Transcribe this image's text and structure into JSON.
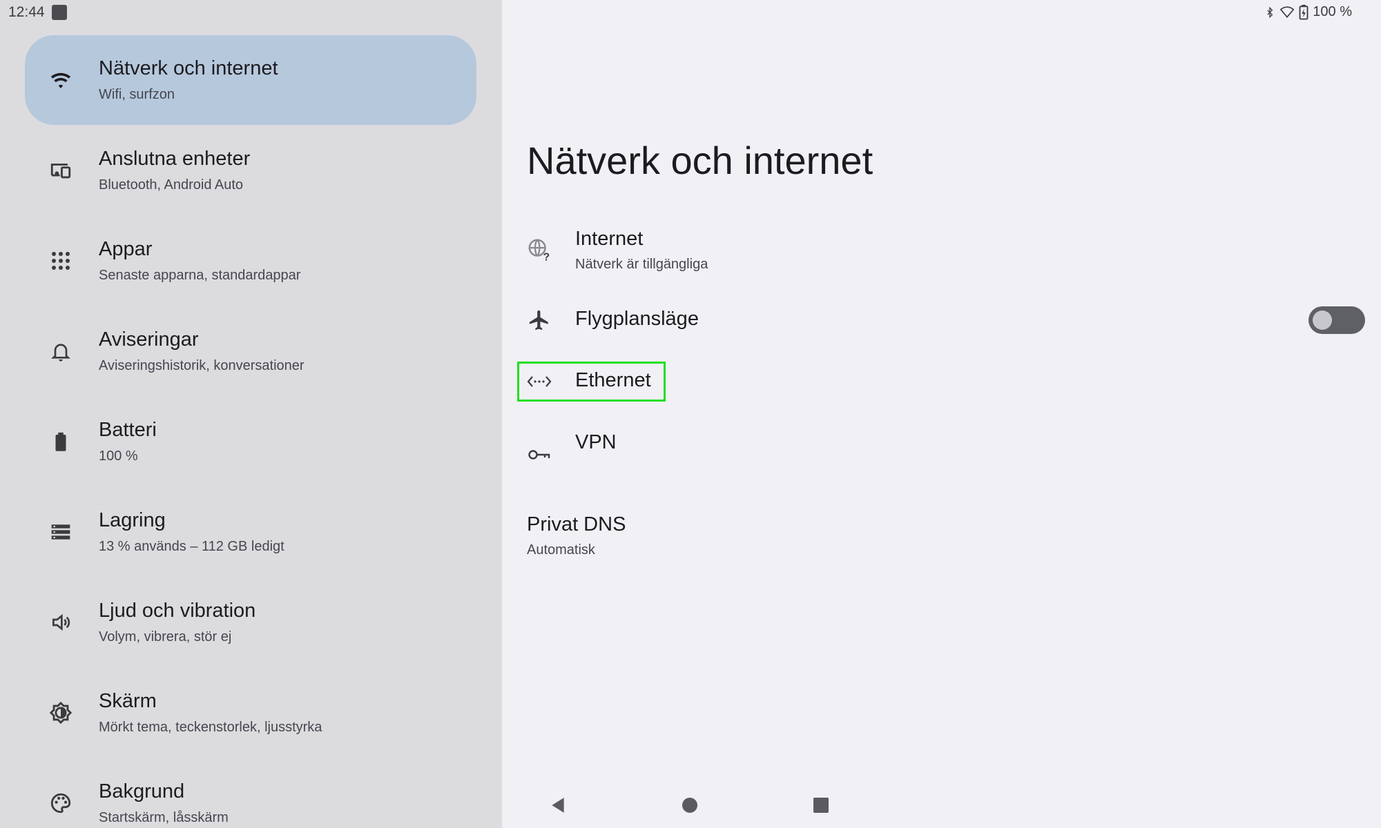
{
  "status_bar": {
    "time": "12:44",
    "battery_text": "100 %",
    "icons": [
      "notification-icon",
      "bluetooth-icon",
      "wifi-icon",
      "battery-icon"
    ]
  },
  "sidebar": {
    "items": [
      {
        "title": "Nätverk och internet",
        "subtitle": "Wifi, surfzon",
        "icon": "wifi-icon",
        "selected": true
      },
      {
        "title": "Anslutna enheter",
        "subtitle": "Bluetooth, Android Auto",
        "icon": "devices-icon"
      },
      {
        "title": "Appar",
        "subtitle": "Senaste apparna, standardappar",
        "icon": "apps-grid-icon"
      },
      {
        "title": "Aviseringar",
        "subtitle": "Aviseringshistorik, konversationer",
        "icon": "bell-icon"
      },
      {
        "title": "Batteri",
        "subtitle": "100 %",
        "icon": "battery-icon"
      },
      {
        "title": "Lagring",
        "subtitle": "13 % används – 112 GB ledigt",
        "icon": "storage-icon"
      },
      {
        "title": "Ljud och vibration",
        "subtitle": "Volym, vibrera, stör ej",
        "icon": "volume-icon"
      },
      {
        "title": "Skärm",
        "subtitle": "Mörkt tema, teckenstorlek, ljusstyrka",
        "icon": "brightness-icon"
      },
      {
        "title": "Bakgrund",
        "subtitle": "Startskärm, låsskärm",
        "icon": "palette-icon"
      }
    ]
  },
  "main": {
    "title": "Nätverk och internet",
    "items": [
      {
        "title": "Internet",
        "subtitle": "Nätverk är tillgängliga",
        "icon": "globe-question-icon"
      },
      {
        "title": "Flygplansläge",
        "icon": "airplane-icon",
        "toggle_on": false
      },
      {
        "title": "Ethernet",
        "icon": "ethernet-icon",
        "highlighted": true
      },
      {
        "title": "VPN",
        "icon": "key-icon"
      },
      {
        "title": "Privat DNS",
        "subtitle": "Automatisk"
      }
    ]
  },
  "colors": {
    "sidebar_bg": "#dcdcdf",
    "selected_bg": "#b6c8dc",
    "main_bg": "#f1f0f5",
    "highlight": "#22e022"
  }
}
